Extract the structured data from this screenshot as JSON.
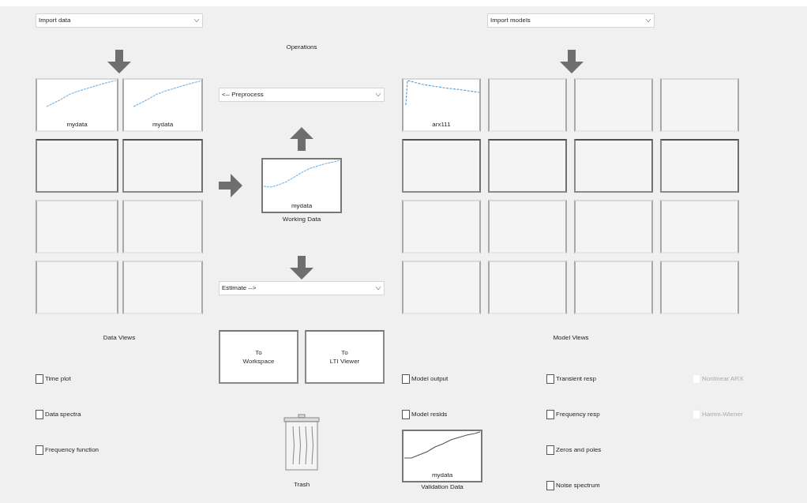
{
  "data_import": {
    "value": "Import data"
  },
  "data_board": {
    "slots": [
      {
        "kind": "data",
        "label": "mydata"
      },
      {
        "kind": "data",
        "label": "mydata"
      },
      {
        "kind": "empty"
      },
      {
        "kind": "empty"
      },
      {
        "kind": "empty"
      },
      {
        "kind": "empty"
      },
      {
        "kind": "empty"
      },
      {
        "kind": "empty"
      }
    ]
  },
  "operations": {
    "title": "Operations",
    "preprocess": {
      "value": "<-- Preprocess"
    },
    "working_data": {
      "label": "mydata",
      "caption": "Working Data"
    },
    "estimate": {
      "value": "Estimate -->"
    }
  },
  "export_buttons": [
    "To\nWorkspace",
    "To\nLTI Viewer"
  ],
  "trash": {
    "label": "Trash"
  },
  "data_views": {
    "title": "Data Views",
    "options": [
      {
        "label": "Time plot",
        "checked": false
      },
      {
        "label": "Data spectra",
        "checked": false
      },
      {
        "label": "Frequency function",
        "checked": false
      }
    ]
  },
  "model_import": {
    "value": "Import models"
  },
  "model_board": {
    "slots": [
      {
        "kind": "model",
        "label": "arx111"
      },
      {
        "kind": "empty"
      },
      {
        "kind": "empty"
      },
      {
        "kind": "empty"
      },
      {
        "kind": "empty"
      },
      {
        "kind": "empty"
      },
      {
        "kind": "empty"
      },
      {
        "kind": "empty"
      },
      {
        "kind": "empty"
      },
      {
        "kind": "empty"
      },
      {
        "kind": "empty"
      },
      {
        "kind": "empty"
      },
      {
        "kind": "empty"
      },
      {
        "kind": "empty"
      },
      {
        "kind": "empty"
      },
      {
        "kind": "empty"
      }
    ]
  },
  "model_views": {
    "title": "Model Views",
    "columns": [
      [
        {
          "label": "Model output",
          "checked": false,
          "disabled": false
        },
        {
          "label": "Model resids",
          "checked": false,
          "disabled": false
        }
      ],
      [
        {
          "label": "Transient resp",
          "checked": false,
          "disabled": false
        },
        {
          "label": "Frequency resp",
          "checked": false,
          "disabled": false
        },
        {
          "label": "Zeros and poles",
          "checked": false,
          "disabled": false
        },
        {
          "label": "Noise spectrum",
          "checked": false,
          "disabled": false
        }
      ],
      [
        {
          "label": "Nonlinear ARX",
          "checked": false,
          "disabled": true
        },
        {
          "label": "Hamm-Wiener",
          "checked": false,
          "disabled": true
        }
      ]
    ],
    "validation_data": {
      "label": "mydata",
      "caption": "Validation Data"
    }
  }
}
